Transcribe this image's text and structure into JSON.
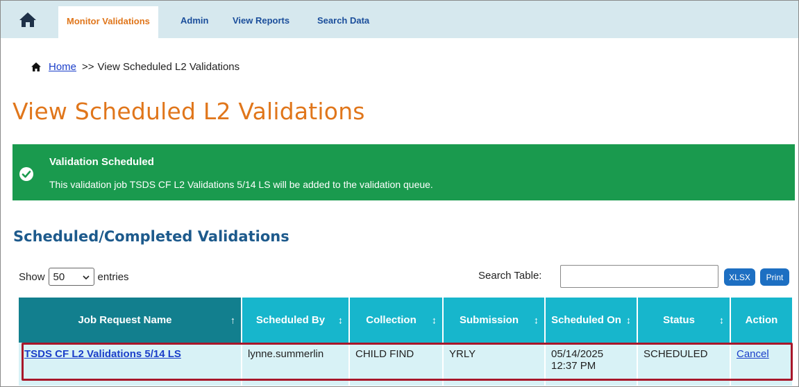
{
  "nav": {
    "home_icon": "house-icon",
    "items": [
      {
        "label": "Monitor Validations",
        "active": true
      },
      {
        "label": "Admin",
        "active": false
      },
      {
        "label": "View Reports",
        "active": false
      },
      {
        "label": "Search Data",
        "active": false
      }
    ]
  },
  "breadcrumb": {
    "home_label": "Home",
    "separator": ">>",
    "current": "View Scheduled L2 Validations"
  },
  "page_title": "View Scheduled L2 Validations",
  "alert": {
    "icon": "check-circle-icon",
    "title": "Validation Scheduled",
    "message": "This validation job TSDS CF L2 Validations 5/14 LS will be added to the validation queue.",
    "color": "#1a9a4e"
  },
  "section_title": "Scheduled/Completed Validations",
  "controls": {
    "show_label": "Show",
    "page_size": "50",
    "entries_label": "entries",
    "search_label": "Search Table:",
    "search_value": "",
    "xlsx_label": "XLSX",
    "print_label": "Print"
  },
  "table": {
    "columns": [
      {
        "label": "Job Request Name",
        "sort": "↑"
      },
      {
        "label": "Scheduled By",
        "sort": "↕"
      },
      {
        "label": "Collection",
        "sort": "↕"
      },
      {
        "label": "Submission",
        "sort": "↕"
      },
      {
        "label": "Scheduled On",
        "sort": "↕"
      },
      {
        "label": "Status",
        "sort": "↕"
      },
      {
        "label": "Action",
        "sort": ""
      }
    ],
    "rows": [
      {
        "job": "TSDS CF L2 Validations 5/14 LS",
        "scheduled_by": "lynne.summerlin",
        "collection": "CHILD FIND",
        "submission": "YRLY",
        "scheduled_on_date": "05/14/2025",
        "scheduled_on_time": "12:37 PM",
        "status": "SCHEDULED",
        "action": "Cancel"
      }
    ]
  },
  "colors": {
    "accent_orange": "#e0761b",
    "header_teal": "#17b6cc",
    "header_teal_dark": "#127f8e",
    "row_bg": "#d8f2f6",
    "highlight_red": "#a8172a"
  }
}
